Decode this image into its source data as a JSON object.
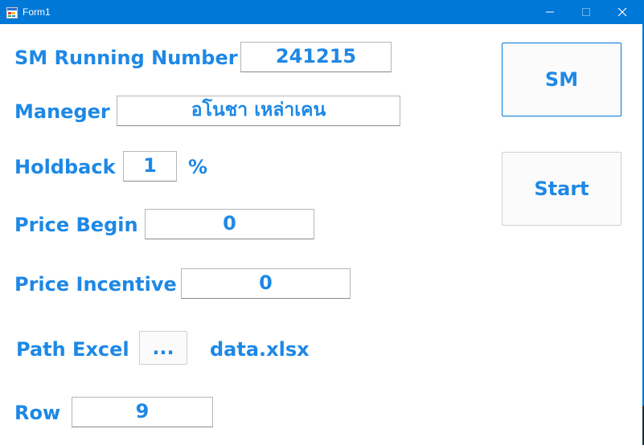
{
  "window": {
    "title": "Form1",
    "icon": "app-form-icon",
    "controls": [
      "minimize-icon",
      "maximize-icon",
      "close-icon"
    ]
  },
  "form": {
    "sm_running_number": {
      "label": "SM Running Number",
      "value": "241215"
    },
    "manager": {
      "label": "Maneger",
      "value": "อโนชา เหล่าเคน"
    },
    "holdback": {
      "label": "Holdback",
      "value": "1",
      "unit": "%"
    },
    "price_begin": {
      "label": "Price Begin",
      "value": "0"
    },
    "price_incentive": {
      "label": "Price Incentive",
      "value": "0"
    },
    "path_excel": {
      "label": "Path Excel",
      "browse_label": "...",
      "file_name": "data.xlsx"
    },
    "row": {
      "label": "Row",
      "value": "9"
    }
  },
  "buttons": {
    "sm": "SM",
    "start": "Start"
  },
  "colors": {
    "titlebar": "#0078d7",
    "text_accent": "#1e88e5",
    "background": "#ffffff"
  }
}
